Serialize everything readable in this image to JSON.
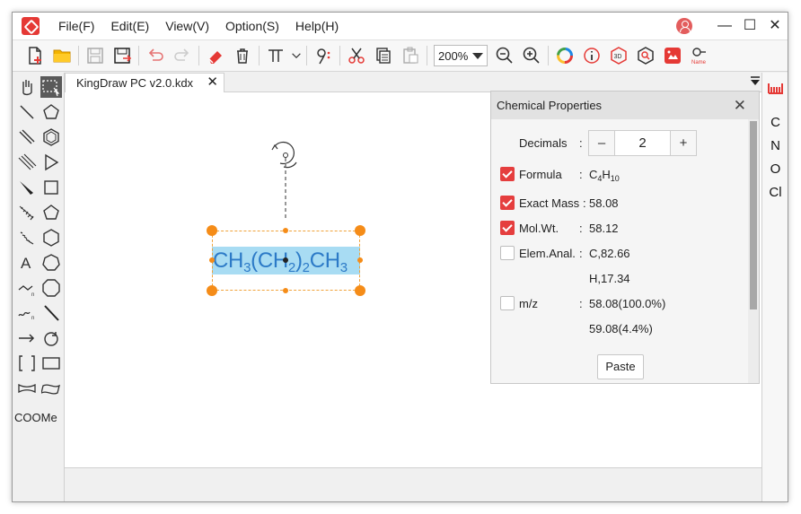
{
  "app": {
    "menu": [
      "File(F)",
      "Edit(E)",
      "View(V)",
      "Option(S)",
      "Help(H)"
    ],
    "window_controls": [
      "minimize",
      "maximize",
      "close"
    ]
  },
  "toolbar": {
    "zoom_value": "200%",
    "buttons": [
      "new-file",
      "open-folder",
      "save",
      "save-as",
      "undo",
      "redo",
      "eraser",
      "delete",
      "text-tool",
      "chain-tool",
      "cut",
      "copy",
      "paste",
      "zoom-out",
      "zoom-in",
      "color-wheel",
      "info",
      "3d-view",
      "search-structure",
      "image-recognition",
      "name-to-structure"
    ]
  },
  "tab": {
    "title": "KingDraw PC v2.0.kdx"
  },
  "canvas": {
    "molecule": {
      "parts": [
        "CH",
        "3",
        "(CH",
        "2",
        ")",
        "2",
        "CH",
        "3"
      ]
    }
  },
  "panel": {
    "title": "Chemical Properties",
    "decimals_label": "Decimals",
    "decimals_value": "2",
    "minus": "–",
    "plus": "+",
    "formula_label": "Formula",
    "formula": {
      "c": "C",
      "c_n": "4",
      "h": "H",
      "h_n": "10"
    },
    "exact_mass_label": "Exact Mass",
    "exact_mass": "58.08",
    "mol_wt_label": "Mol.Wt.",
    "mol_wt": "58.12",
    "elem_anal_label": "Elem.Anal.",
    "elem_anal_c": "C,82.66",
    "elem_anal_h": "H,17.34",
    "mz_label": "m/z",
    "mz_1": "58.08(100.0%)",
    "mz_2": "59.08(4.4%)",
    "paste_label": "Paste",
    "checks": {
      "formula": true,
      "exact_mass": true,
      "mol_wt": true,
      "elem_anal": false,
      "mz": false
    }
  },
  "rightbar": {
    "elements": [
      "C",
      "N",
      "O",
      "Cl"
    ]
  },
  "lefttools": {
    "coome_label": "COOMe"
  }
}
